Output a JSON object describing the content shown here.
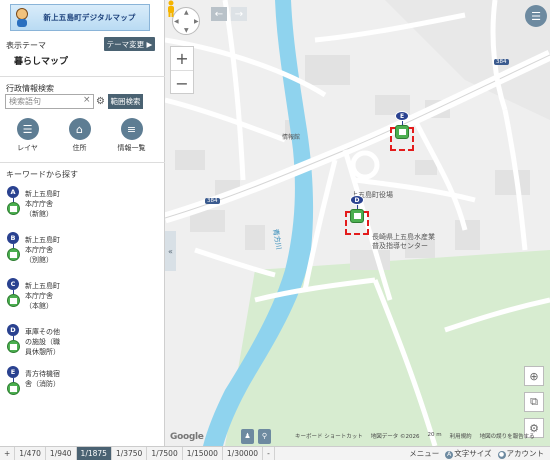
{
  "app": {
    "logo_text": "新上五島町デジタルマップ"
  },
  "theme": {
    "label": "表示テーマ",
    "change_button": "テーマ変更 ▶",
    "name": "暮らしマップ"
  },
  "search": {
    "label": "行政情報検索",
    "placeholder": "検索語句",
    "clear": "×",
    "range_button": "範囲検索"
  },
  "tools": [
    {
      "label": "レイヤ",
      "icon": "layers-icon"
    },
    {
      "label": "住所",
      "icon": "home-icon"
    },
    {
      "label": "情報一覧",
      "icon": "list-icon"
    }
  ],
  "keyword": {
    "label": "キーワードから探す",
    "items": [
      {
        "badge": "A",
        "text": "新上五島町本庁庁舎（新館）"
      },
      {
        "badge": "B",
        "text": "新上五島町本庁庁舎（別館）"
      },
      {
        "badge": "C",
        "text": "新上五島町本庁庁舎（本館）"
      },
      {
        "badge": "D",
        "text": "車庫その他の施設（職員休憩所）"
      },
      {
        "badge": "E",
        "text": "青方待機宿舎（消防）"
      }
    ]
  },
  "scale": {
    "plus": "+",
    "options": [
      "1/470",
      "1/940",
      "1/1875",
      "1/3750",
      "1/7500",
      "1/15000",
      "1/30000",
      "-"
    ],
    "active": "1/1875",
    "links": [
      "メニュー",
      "文字サイズ",
      "アカウント"
    ]
  },
  "map": {
    "labels": {
      "bank": "情報館",
      "town_hall": "上五島町役場",
      "fisheries_1": "長崎県上五島水産業",
      "fisheries_2": "普及指導センター",
      "river": "青方川"
    },
    "route_shields": [
      "384",
      "384"
    ],
    "markers": [
      {
        "badge": "E"
      },
      {
        "badge": "D"
      }
    ],
    "footer": {
      "shortcuts": "キーボード ショートカット",
      "mapdata": "地図データ ©2026",
      "scale": "20 m",
      "terms": "利用規約",
      "report": "地図の誤りを報告する"
    },
    "google": "Google",
    "colors": {
      "river": "#8fd3ee",
      "road": "#ffffff",
      "green": "#d7ecd0",
      "brand": "#4a6272"
    }
  }
}
